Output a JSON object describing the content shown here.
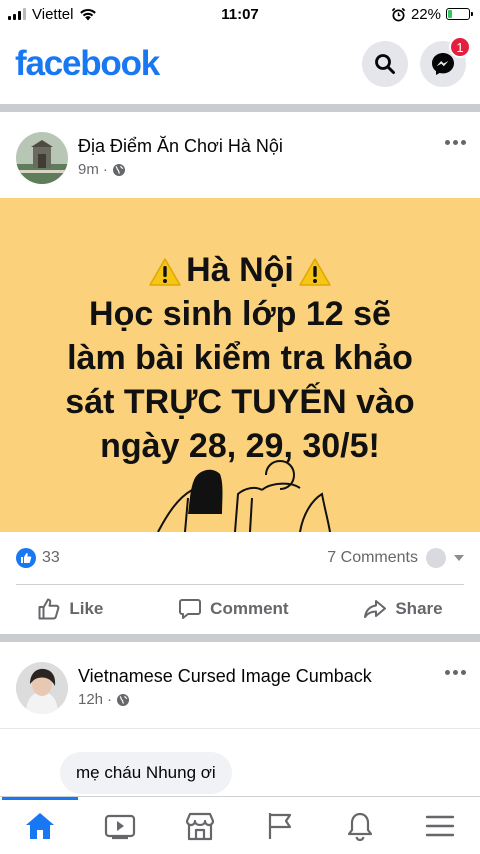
{
  "status_bar": {
    "carrier": "Viettel",
    "time": "11:07",
    "battery_percent": "22%",
    "battery_level": 0.22
  },
  "header": {
    "logo": "facebook",
    "messenger_badge": "1"
  },
  "post1": {
    "author": "Địa Điểm Ăn Chơi Hà Nội",
    "time": "9m",
    "image_text": {
      "line1": "Hà Nội",
      "line2": "Học sinh lớp 12 sẽ",
      "line3": "làm bài kiểm tra khảo",
      "line4": "sát TRỰC TUYẾN vào",
      "line5": "ngày 28, 29, 30/5!"
    },
    "like_count": "33",
    "comments_count": "7 Comments",
    "actions": {
      "like": "Like",
      "comment": "Comment",
      "share": "Share"
    }
  },
  "post2": {
    "author": "Vietnamese Cursed Image Cumback",
    "time": "12h",
    "comment_preview": "mẹ cháu Nhung ơi"
  },
  "colors": {
    "brand": "#1877f2",
    "image_bg": "#fbd27b",
    "badge": "#e41e3f"
  }
}
